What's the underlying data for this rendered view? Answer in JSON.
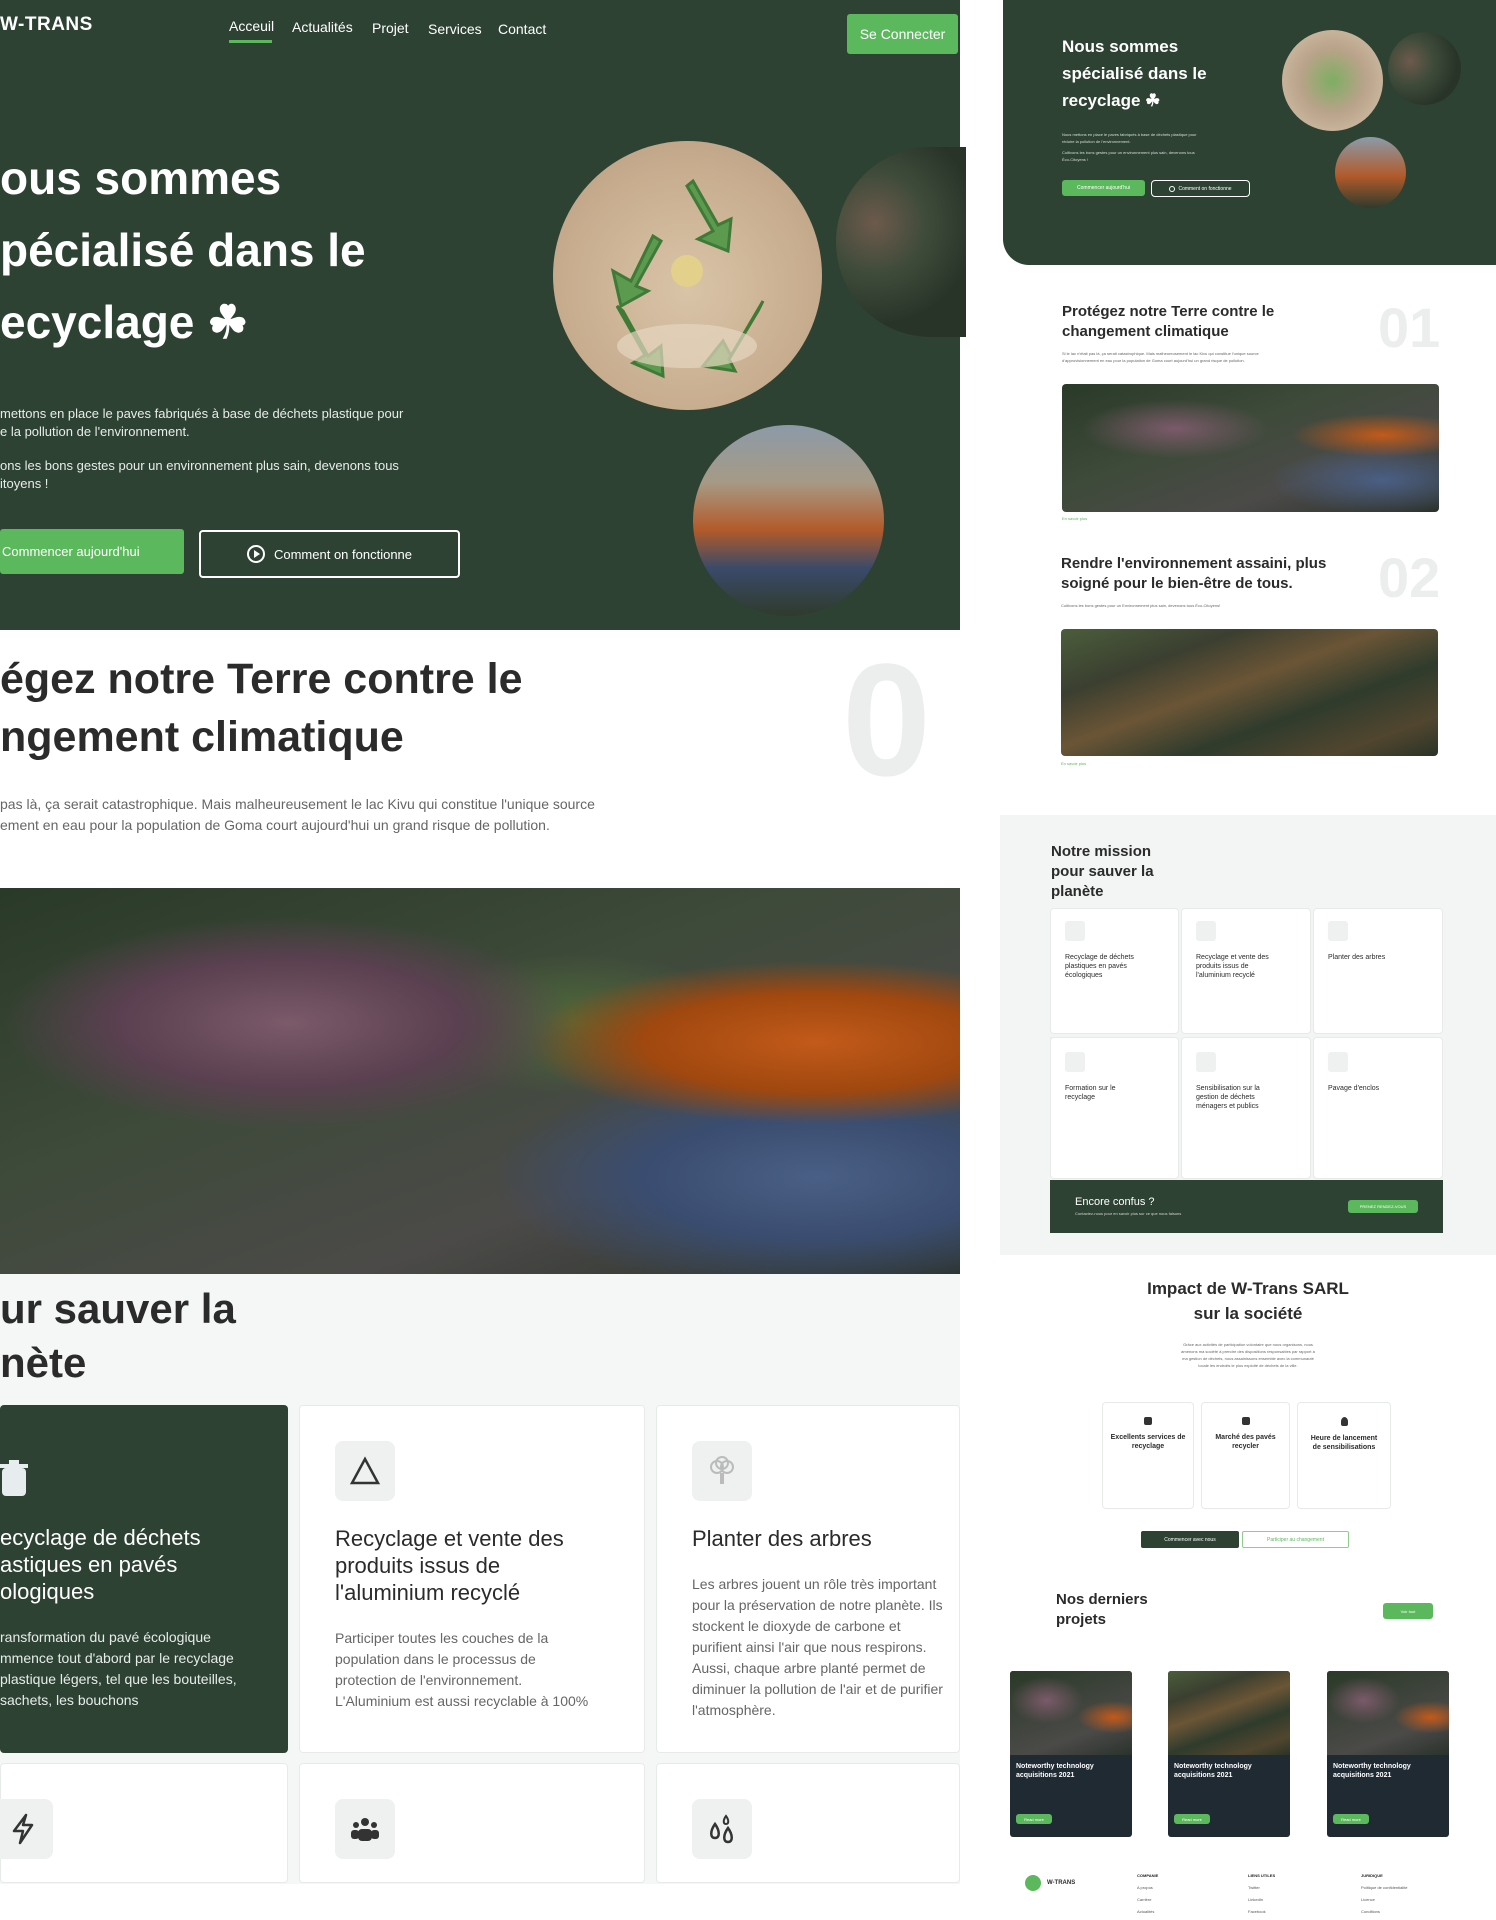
{
  "nav": {
    "logo": "W-TRANS",
    "items": [
      "Acceuil",
      "Actualités",
      "Projet",
      "Services",
      "Contact"
    ],
    "login": "Se Connecter"
  },
  "hero": {
    "title_lines": [
      "ous sommes",
      "pécialisé dans le",
      "ecyclage ☘"
    ],
    "para1_lines": [
      "mettons en place le paves fabriqués à base de déchets plastique pour",
      "e la pollution de l'environnement."
    ],
    "para2_lines": [
      "ons les bons gestes pour un environnement plus sain, devenons tous",
      "itoyens !"
    ],
    "cta_primary": "Commencer aujourd'hui",
    "cta_secondary": "Comment on fonctionne"
  },
  "section1": {
    "title_lines": [
      "égez notre Terre contre le",
      "ngement climatique"
    ],
    "text_lines": [
      "pas là, ça serait catastrophique. Mais malheureusement le lac Kivu qui constitue l'unique source",
      "ement en eau pour la population de Goma court aujourd'hui un grand risque de pollution."
    ],
    "number": "0"
  },
  "mission": {
    "title_lines": [
      "ur sauver la",
      "nète"
    ],
    "cards": [
      {
        "icon": "trash-icon",
        "title_lines": [
          "ecyclage de déchets",
          "astiques en pavés",
          "ologiques"
        ],
        "text_lines": [
          "ransformation du pavé écologique",
          "mmence tout d'abord par le recyclage",
          "plastique légers, tel que les bouteilles,",
          "sachets, les bouchons"
        ]
      },
      {
        "icon": "triangle-icon",
        "title_lines": [
          "Recyclage et vente des",
          "produits issus de",
          "l'aluminium recyclé"
        ],
        "text_lines": [
          "Participer toutes les couches de la",
          "population dans le processus de",
          "protection de l'environnement.",
          "L'Aluminium est aussi recyclable à 100%"
        ]
      },
      {
        "icon": "tree-icon",
        "title_lines": [
          "Planter des arbres"
        ],
        "text_lines": [
          "Les arbres jouent un rôle très important",
          "pour la préservation de notre planète. Ils",
          "stockent le dioxyde de carbone et",
          "purifient ainsi l'air que nous respirons.",
          "Aussi, chaque arbre planté permet de",
          "diminuer la pollution de l'air et de purifier",
          "l'atmosphère."
        ]
      }
    ],
    "row2_icons": [
      "bolt-icon",
      "group-icon",
      "drops-icon"
    ]
  },
  "thumb": {
    "hero": {
      "title_lines": [
        "Nous sommes",
        "spécialisé dans le",
        "recyclage ☘"
      ],
      "text_lines": [
        "Nous mettons en place le paves fabriqués à base de déchets plastique pour",
        "réduire la pollution de l'environnement.",
        "Cultivons les bons gestes pour un environnement plus sain, devenons tous",
        "Éco-Citoyens !"
      ],
      "cta_primary": "Commencer aujourd'hui",
      "cta_secondary": "Comment on fonctionne"
    },
    "feature1": {
      "title_lines": [
        "Protégez notre Terre contre le",
        "changement climatique"
      ],
      "number": "01",
      "text_lines": [
        "Si le lac n'était pas là, ça serait catastrophique. Mais malheureusement le lac Kivu qui constitue l'unique source",
        "d'approvisionnement en eau pour la population de Goma court aujourd'hui un grand risque de pollution."
      ],
      "link": "En savoir plus"
    },
    "feature2": {
      "title_lines": [
        "Rendre l'environnement assaini, plus",
        "soigné pour le bien-être de tous."
      ],
      "number": "02",
      "text_lines": [
        "Cultivons les bons gestes pour un Environnement plus sain, devenons tous Éco-Citoyens!"
      ],
      "link": "En savoir plus"
    },
    "mission": {
      "title_lines": [
        "Notre mission",
        "pour sauver la",
        "planète"
      ],
      "cards": [
        {
          "icon": "trash-icon",
          "title_lines": [
            "Recyclage de déchets",
            "plastiques en pavés",
            "écologiques"
          ]
        },
        {
          "icon": "triangle-icon",
          "title_lines": [
            "Recyclage et vente des",
            "produits issus de",
            "l'aluminium recyclé"
          ]
        },
        {
          "icon": "tree-icon",
          "title_lines": [
            "Planter des arbres"
          ]
        },
        {
          "icon": "bolt-icon",
          "title_lines": [
            "Formation sur le",
            "recyclage"
          ]
        },
        {
          "icon": "group-icon",
          "title_lines": [
            "Sensibilisation sur la",
            "gestion de déchets",
            "ménagers et publics"
          ]
        },
        {
          "icon": "drops-icon",
          "title_lines": [
            "Pavage d'enclos"
          ]
        }
      ],
      "confus_title": "Encore confus ?",
      "confus_text": "Contactez-nous pour en savoir plus sur ce que nous faisons",
      "confus_btn": "PRENEZ RENDEZ-VOUS"
    },
    "impact": {
      "title_lines": [
        "Impact de W-Trans SARL",
        "sur la société"
      ],
      "text_lines": [
        "Grâce aux activités de participation volontaire que nous organisons, nous",
        "amenons ma société à prendre des dispositions responsables par rapport à",
        "ma gestion de déchets, nous assainissons ensemble avec la communauté",
        "locale les endroits le plus exploité de déchets de la ville."
      ],
      "cards": [
        {
          "icon": "recycle-small-icon",
          "title_lines": [
            "Excellents services de",
            "recyclage"
          ]
        },
        {
          "icon": "box-small-icon",
          "title_lines": [
            "Marché des pavés",
            "recycler"
          ]
        },
        {
          "icon": "bulb-small-icon",
          "title_lines": [
            "Heure de lancement",
            "de sensibilisations"
          ]
        }
      ],
      "btn_primary": "Commencer avec nous",
      "btn_secondary": "Participer au changement"
    },
    "projects": {
      "title_lines": [
        "Nos derniers",
        "projets"
      ],
      "btn": "Voir tout",
      "cards": [
        {
          "title_lines": [
            "Noteworthy technology",
            "acquisitions 2021"
          ],
          "btn": "Read more"
        },
        {
          "title_lines": [
            "Noteworthy technology",
            "acquisitions 2021"
          ],
          "btn": "Read more"
        },
        {
          "title_lines": [
            "Noteworthy technology",
            "acquisitions 2021"
          ],
          "btn": "Read more"
        }
      ]
    },
    "footer": {
      "logo": "W-TRANS",
      "cols": [
        {
          "title": "COMPANIE",
          "items": [
            "A propos",
            "Carrière",
            "Actualités"
          ]
        },
        {
          "title": "LIENS UTILES",
          "items": [
            "Twitter",
            "LinkedIn",
            "Facebook"
          ]
        },
        {
          "title": "JURIDIQUE",
          "items": [
            "Politique de confidentialité",
            "Licence",
            "Conditions"
          ]
        }
      ]
    }
  }
}
